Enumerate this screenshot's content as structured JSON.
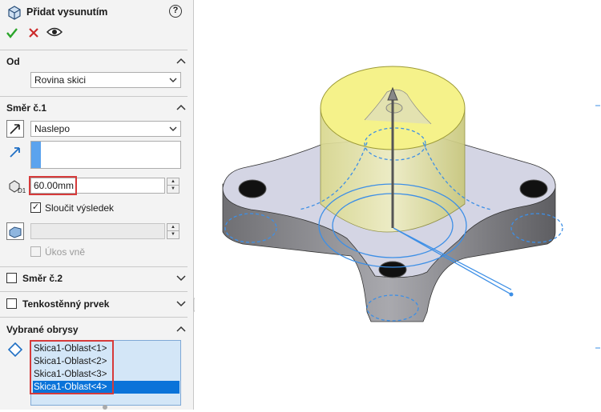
{
  "feature": {
    "title": "Přidat vysunutím",
    "help_glyph": "?"
  },
  "actions": {
    "ok": "check-icon",
    "cancel": "x-icon",
    "preview": "eye-icon"
  },
  "from": {
    "header": "Od",
    "value": "Rovina skici"
  },
  "direction1": {
    "header": "Směr č.1",
    "end_condition": "Naslepo",
    "reverse_dir_icon": "reverse-direction-icon",
    "direction_icon": "direction-arrow-icon",
    "depth_value": "60.00mm",
    "depth_icon": "depth-d1-icon",
    "merge_label": "Sloučit výsledek",
    "merge_checked": true,
    "draft_label": "Úkos vně",
    "draft_checked": false
  },
  "direction2": {
    "header": "Směr č.2",
    "checked": false
  },
  "thin": {
    "header": "Tenkostěnný prvek",
    "checked": false
  },
  "contours": {
    "header": "Vybrané obrysy",
    "items": [
      "Skica1-Oblast<1>",
      "Skica1-Oblast<2>",
      "Skica1-Oblast<3>",
      "Skica1-Oblast<4>"
    ],
    "selected_index": 3
  },
  "colors": {
    "accent": "#0a73d9",
    "highlight": "#d63a3a",
    "preview_yellow": "#f5f28a",
    "sketch_blue": "#3d8fe6"
  }
}
